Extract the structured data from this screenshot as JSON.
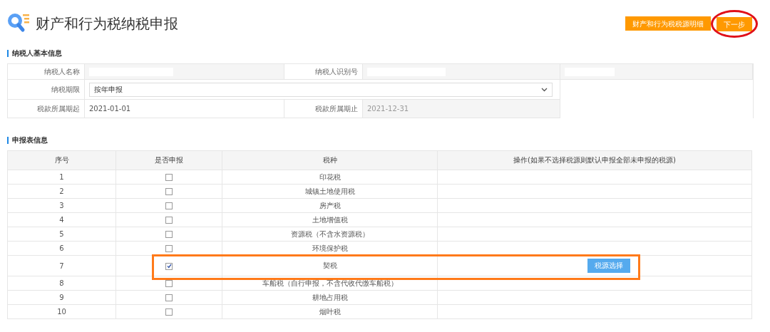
{
  "page": {
    "title": "财产和行为税纳税申报"
  },
  "buttons": [
    {
      "label": "财产和行为税税源明细",
      "circled": false
    },
    {
      "label": "下一步",
      "circled": true
    }
  ],
  "taxpayer_section": {
    "heading": "纳税人基本信息",
    "name_label": "纳税人名称",
    "id_label": "纳税人识别号",
    "period_label": "纳税期限",
    "period_value": "按年申报",
    "start_label": "税款所属期起",
    "start_value": "2021-01-01",
    "end_label": "税款所属期止",
    "end_value": "2021-12-31",
    "end_disabled": true
  },
  "declaration_section": {
    "heading": "申报表信息",
    "columns": [
      "序号",
      "是否申报",
      "税种",
      "操作(如果不选择税源则默认申报全部未申报的税源)"
    ],
    "rows": [
      {
        "no": "1",
        "checked": false,
        "tax": "印花税"
      },
      {
        "no": "2",
        "checked": false,
        "tax": "城镇土地使用税"
      },
      {
        "no": "3",
        "checked": false,
        "tax": "房产税"
      },
      {
        "no": "4",
        "checked": false,
        "tax": "土地增值税"
      },
      {
        "no": "5",
        "checked": false,
        "tax": "资源税（不含水资源税）"
      },
      {
        "no": "6",
        "checked": false,
        "tax": "环境保护税"
      },
      {
        "no": "7",
        "checked": true,
        "tax": "契税",
        "action": "税源选择",
        "highlighted": true
      },
      {
        "no": "8",
        "checked": false,
        "tax": "车船税（自行申报，不含代收代缴车船税）"
      },
      {
        "no": "9",
        "checked": false,
        "tax": "耕地占用税"
      },
      {
        "no": "10",
        "checked": false,
        "tax": "烟叶税"
      }
    ]
  }
}
